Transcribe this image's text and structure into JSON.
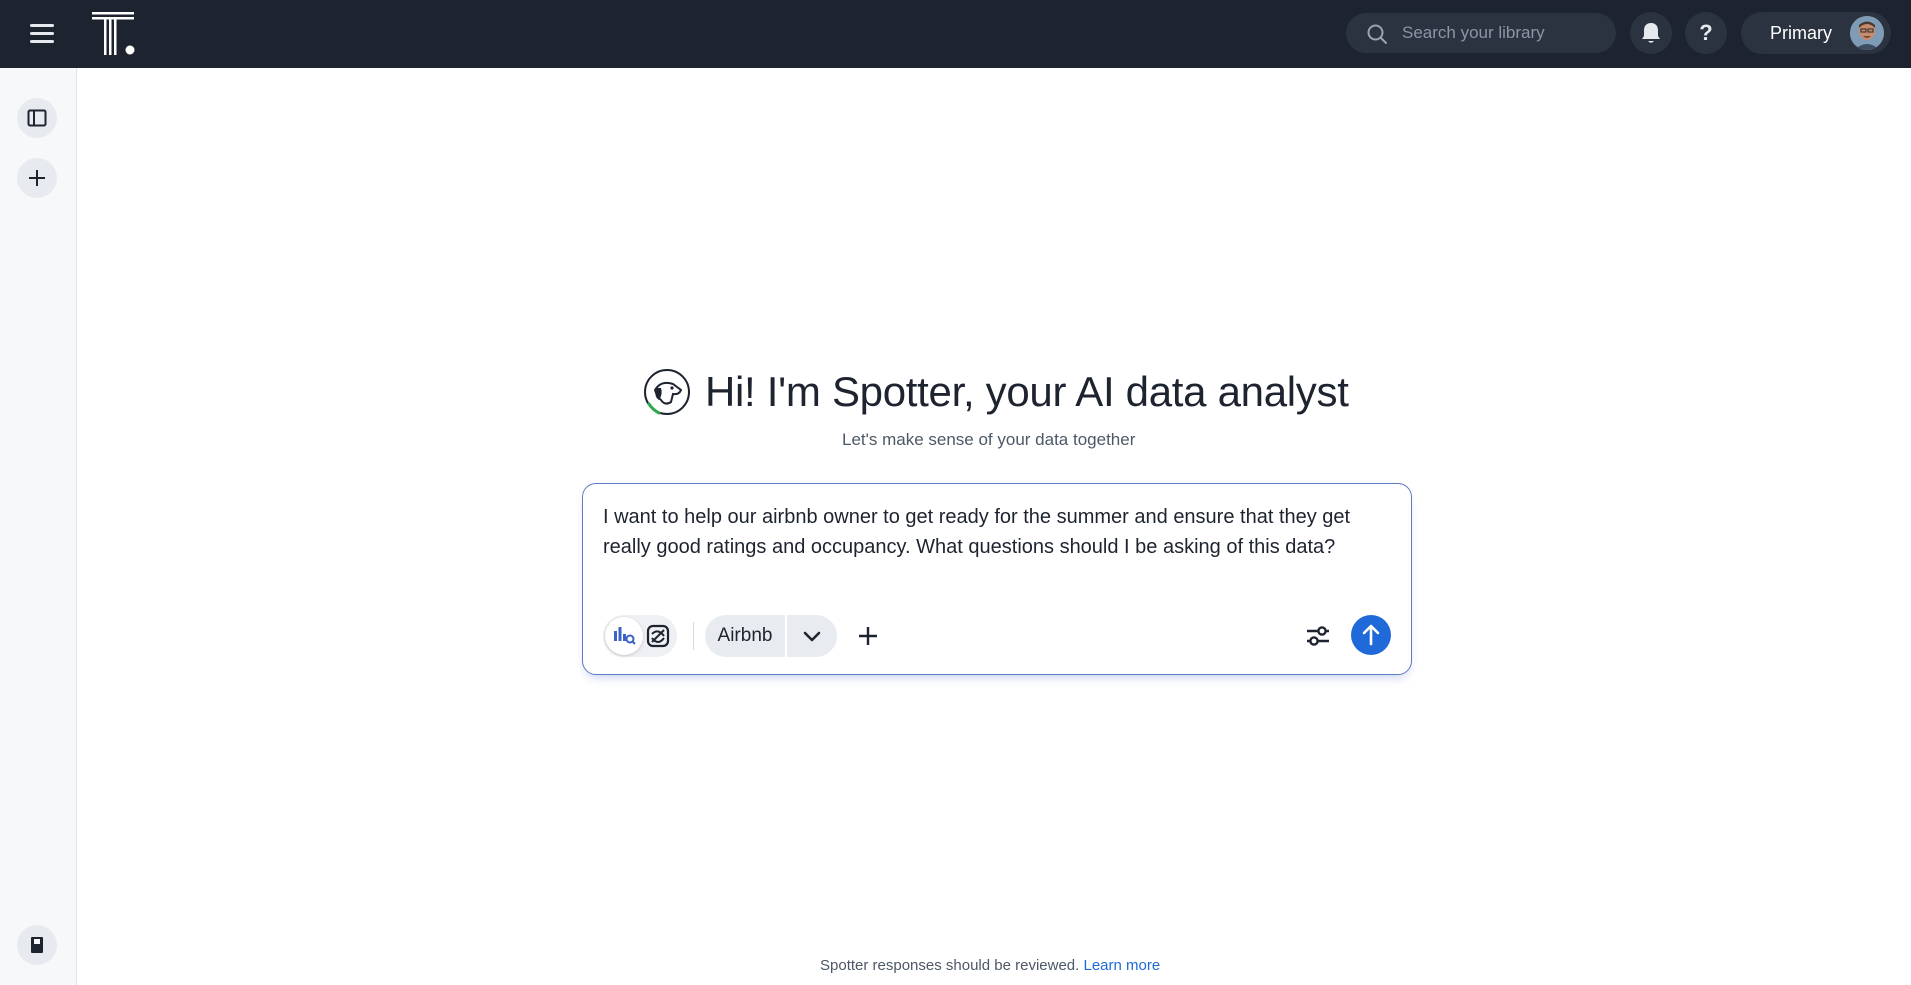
{
  "topbar": {
    "menu_icon": "hamburger-menu-icon",
    "logo_icon": "thoughtspot-logo",
    "search": {
      "placeholder": "Search your library",
      "icon": "search-icon"
    },
    "notifications_icon": "bell-icon",
    "help_label": "?",
    "org_label": "Primary",
    "avatar_icon": "user-avatar"
  },
  "rail": {
    "items": [
      {
        "icon": "sidebar-toggle-icon"
      },
      {
        "icon": "plus-icon"
      },
      {
        "icon": "notebook-icon"
      }
    ]
  },
  "hero": {
    "icon": "spotter-dog-icon",
    "title": "Hi! I'm Spotter, your AI data analyst",
    "subtitle": "Let's make sense of your data together"
  },
  "prompt": {
    "text": "I want to help our airbnb owner to get ready for the summer and ensure that they get really good ratings and occupancy. What questions should I be asking of this data?",
    "mode_icons": [
      "chart-search-icon",
      "research-knot-icon"
    ],
    "datasource": "Airbnb",
    "datasource_icon": "chevron-down-icon",
    "add_icon": "plus-icon",
    "settings_icon": "sliders-icon",
    "send_icon": "arrow-up-icon"
  },
  "footer": {
    "text": "Spotter responses should be reviewed.",
    "link": "Learn more"
  },
  "colors": {
    "topbar": "#1d232f",
    "accent": "#1f6ad8",
    "prompt_border": "#5b7bc7"
  }
}
